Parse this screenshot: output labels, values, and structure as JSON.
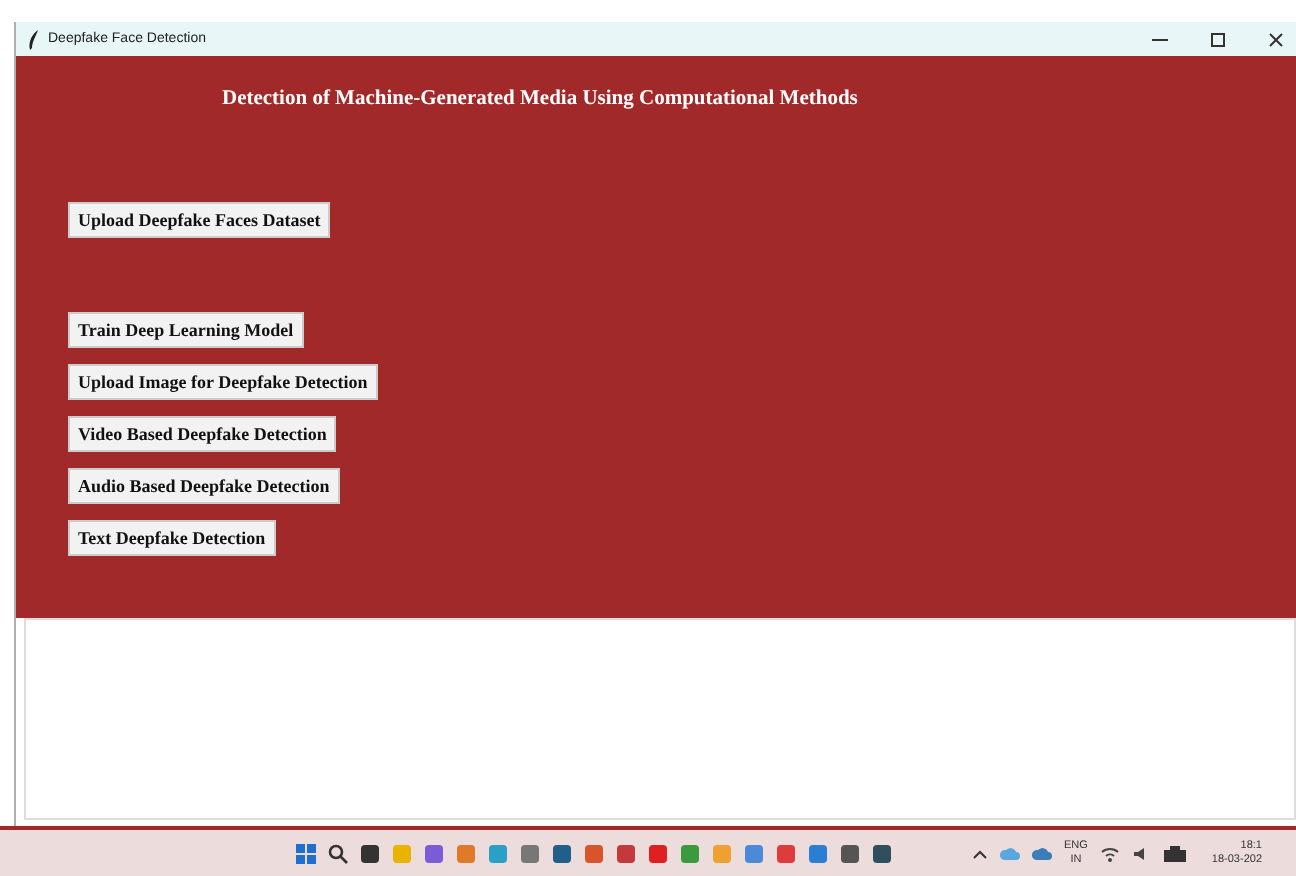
{
  "window": {
    "title": "Deepfake Face Detection"
  },
  "heading": "Detection of Machine-Generated Media Using Computational Methods",
  "buttons": [
    {
      "label": "Upload Deepfake Faces Dataset"
    },
    {
      "label": "Train Deep Learning Model"
    },
    {
      "label": "Upload Image for Deepfake Detection"
    },
    {
      "label": "Video Based Deepfake Detection"
    },
    {
      "label": "Audio Based Deepfake Detection"
    },
    {
      "label": "Text Deepfake Detection"
    }
  ],
  "taskbar": {
    "apps": [
      {
        "kind": "start"
      },
      {
        "kind": "search"
      },
      {
        "kind": "app",
        "color": "#333333"
      },
      {
        "kind": "app",
        "color": "#e8b400"
      },
      {
        "kind": "app",
        "color": "#7b5cd6"
      },
      {
        "kind": "app",
        "color": "#e07a2a"
      },
      {
        "kind": "app",
        "color": "#2aa0c8"
      },
      {
        "kind": "app",
        "color": "#777777"
      },
      {
        "kind": "app",
        "color": "#1f5f8a"
      },
      {
        "kind": "app",
        "color": "#d9542b"
      },
      {
        "kind": "app",
        "color": "#c43a3a"
      },
      {
        "kind": "app",
        "color": "#e02020"
      },
      {
        "kind": "app",
        "color": "#3b9a3b"
      },
      {
        "kind": "app",
        "color": "#f0a030"
      },
      {
        "kind": "app",
        "color": "#4a8ad8"
      },
      {
        "kind": "app",
        "color": "#e03b3b"
      },
      {
        "kind": "app",
        "color": "#2a7fd4"
      },
      {
        "kind": "app",
        "color": "#555555"
      },
      {
        "kind": "app",
        "color": "#2f4f5f"
      }
    ],
    "language": "ENG",
    "region": "IN",
    "time": "18:1",
    "date": "18-03-202"
  }
}
